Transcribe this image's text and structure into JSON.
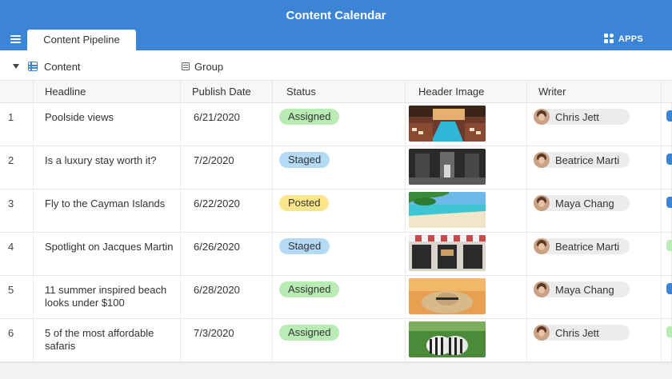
{
  "app": {
    "title": "Content Calendar",
    "tab_label": "Content Pipeline",
    "apps_label": "APPS"
  },
  "viewbar": {
    "view_label": "Content",
    "group_label": "Group"
  },
  "table": {
    "columns": [
      "",
      "Headline",
      "Publish Date",
      "Status",
      "Header Image",
      "Writer"
    ],
    "rows": [
      {
        "num": "1",
        "headline": "Poolside views",
        "date": "6/21/2020",
        "status": "Assigned",
        "status_kind": "assigned",
        "image": "pool-image",
        "writer": "Chris Jett",
        "extra_color": "#3b84d6"
      },
      {
        "num": "2",
        "headline": "Is a luxury stay worth it?",
        "date": "7/2/2020",
        "status": "Staged",
        "status_kind": "staged",
        "image": "hotel-lobby-image",
        "writer": "Beatrice Marti",
        "extra_color": "#3b84d6"
      },
      {
        "num": "3",
        "headline": "Fly to the Cayman Islands",
        "date": "6/22/2020",
        "status": "Posted",
        "status_kind": "posted",
        "image": "beach-image",
        "writer": "Maya Chang",
        "extra_color": "#3b84d6"
      },
      {
        "num": "4",
        "headline": "Spotlight on Jacques Martin",
        "date": "6/26/2020",
        "status": "Staged",
        "status_kind": "staged",
        "image": "storefront-image",
        "writer": "Beatrice Marti",
        "extra_color": "#b9ecb5"
      },
      {
        "num": "5",
        "headline": "11 summer inspired beach looks under $100",
        "date": "6/28/2020",
        "status": "Assigned",
        "status_kind": "assigned",
        "image": "sunhat-image",
        "writer": "Maya Chang",
        "extra_color": "#3b84d6"
      },
      {
        "num": "6",
        "headline": "5 of the most affordable safaris",
        "date": "7/3/2020",
        "status": "Assigned",
        "status_kind": "assigned",
        "image": "zebras-image",
        "writer": "Chris Jett",
        "extra_color": "#b9ecb5"
      }
    ]
  },
  "colors": {
    "accent": "#3b84d6",
    "assigned": "#b9ecb5",
    "staged": "#b4dbf5",
    "posted": "#fbe58b"
  }
}
